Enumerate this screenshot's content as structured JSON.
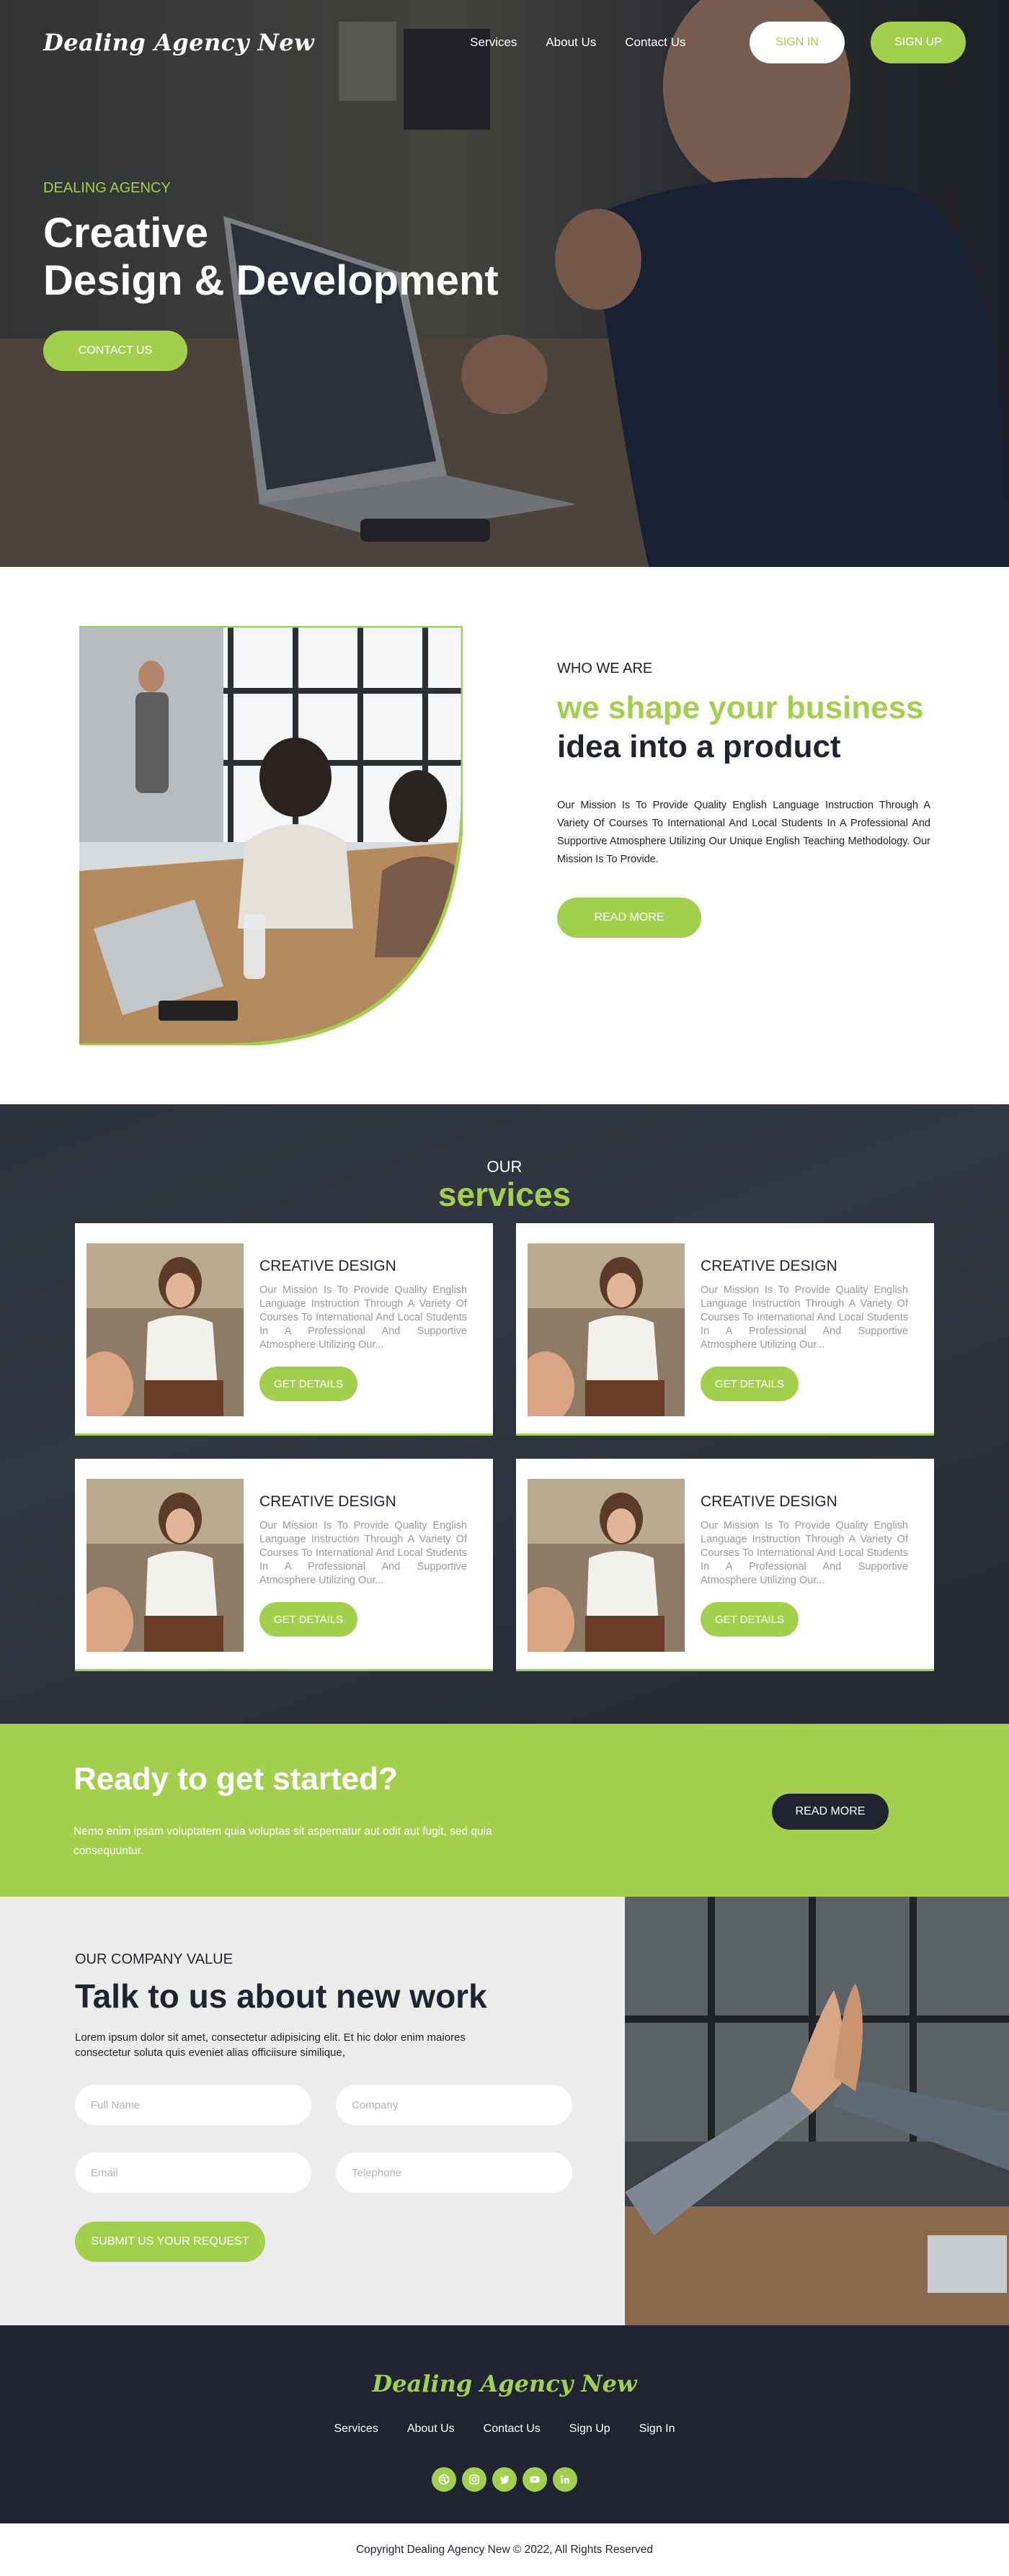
{
  "brand": {
    "logo": "Dealing Agency New",
    "accent": "#a3cf4e",
    "dark": "#1f2430"
  },
  "nav": {
    "links": [
      "Services",
      "About Us",
      "Contact Us"
    ],
    "signin": "SIGN IN",
    "signup": "SIGN UP"
  },
  "hero": {
    "kicker": "DEALING AGENCY",
    "title_line1": "Creative",
    "title_line2": "Design & Development",
    "cta": "CONTACT US"
  },
  "who": {
    "kicker": "WHO WE ARE",
    "title_line1": "we shape your business",
    "title_line2": "idea into a product",
    "body": "Our Mission Is To Provide Quality English Language Instruction Through A Variety Of Courses To International And Local Students In A Professional And Supportive Atmosphere Utilizing Our Unique English Teaching Methodology. Our Mission Is To Provide.",
    "button": "READ MORE"
  },
  "services": {
    "kicker": "OUR",
    "title": "services",
    "cards": [
      {
        "title": "CREATIVE DESIGN",
        "text": "Our Mission Is To Provide Quality English Language Instruction Through A Variety Of Courses To International And Local Students In A Professional And Supportive Atmosphere Utilizing Our...",
        "button": "GET DETAILS"
      },
      {
        "title": "CREATIVE DESIGN",
        "text": "Our Mission Is To Provide Quality English Language Instruction Through A Variety Of Courses To International And Local Students In A Professional And Supportive Atmosphere Utilizing Our...",
        "button": "GET DETAILS"
      },
      {
        "title": "CREATIVE DESIGN",
        "text": "Our Mission Is To Provide Quality English Language Instruction Through A Variety Of Courses To International And Local Students In A Professional And Supportive Atmosphere Utilizing Our...",
        "button": "GET DETAILS"
      },
      {
        "title": "CREATIVE DESIGN",
        "text": "Our Mission Is To Provide Quality English Language Instruction Through A Variety Of Courses To International And Local Students In A Professional And Supportive Atmosphere Utilizing Our...",
        "button": "GET DETAILS"
      }
    ]
  },
  "ready": {
    "title": "Ready to get started?",
    "text": "Nemo enim ipsam voluptatem quia voluptas sit aspernatur aut odit aut fugit, sed quia consequuntur.",
    "button": "READ MORE"
  },
  "contact": {
    "kicker": "OUR COMPANY VALUE",
    "title": "Talk to us about new work",
    "body": "Lorem ipsum dolor sit amet, consectetur adipisicing elit. Et hic dolor enim maiores consectetur soluta quis eveniet alias officiisure similique,",
    "fields": {
      "full_name": "Full Name",
      "company": "Company",
      "email": "Email",
      "telephone": "Telephone"
    },
    "submit": "SUBMIT US YOUR REQUEST"
  },
  "footer": {
    "logo": "Dealing Agency New",
    "links": [
      "Services",
      "About Us",
      "Contact Us",
      "Sign Up",
      "Sign In"
    ],
    "social": [
      "dribbble-icon",
      "instagram-icon",
      "twitter-icon",
      "youtube-icon",
      "linkedin-icon"
    ],
    "copyright": "Copyright  Dealing Agency New  © 2022, All Rights Reserved"
  }
}
